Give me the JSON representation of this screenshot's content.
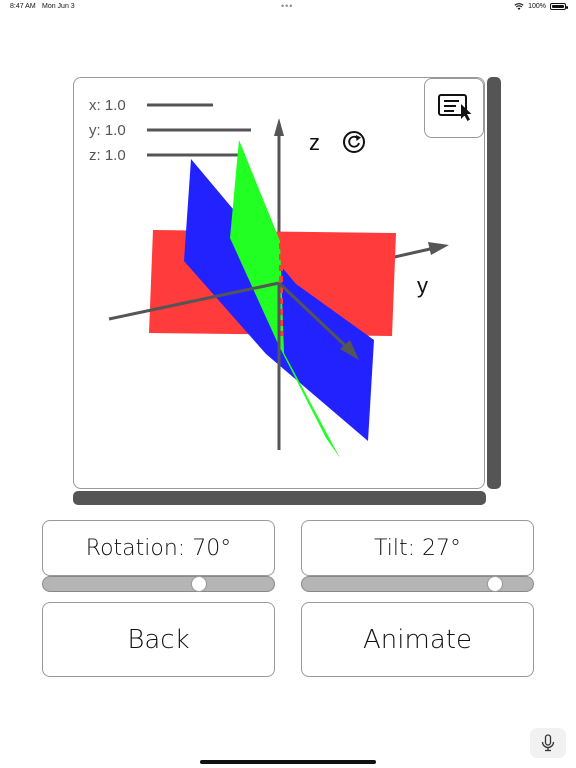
{
  "status_bar": {
    "time": "8:47 AM",
    "date": "Mon Jun 3",
    "dots": "•••",
    "battery_percent": "100%"
  },
  "plot": {
    "legend": [
      {
        "label": "x: 1.0"
      },
      {
        "label": "y: 1.0"
      },
      {
        "label": "z: 1.0"
      }
    ],
    "axis_labels": {
      "z": "z",
      "y": "y"
    },
    "plane_colors": {
      "x": "#2222ff",
      "y": "#ff3b3b",
      "z": "#22ff22"
    },
    "axis_color": "#555555",
    "icons": {
      "reset": "rotate-reset-icon",
      "select": "select-cursor-icon"
    }
  },
  "controls": {
    "rotation_label": "Rotation: 70°",
    "rotation_slider": {
      "value_fraction": 0.69
    },
    "tilt_label": "Tilt: 27°",
    "tilt_slider": {
      "value_fraction": 0.86
    },
    "back_label": "Back",
    "animate_label": "Animate"
  },
  "icons": {
    "mic": "microphone-icon"
  }
}
